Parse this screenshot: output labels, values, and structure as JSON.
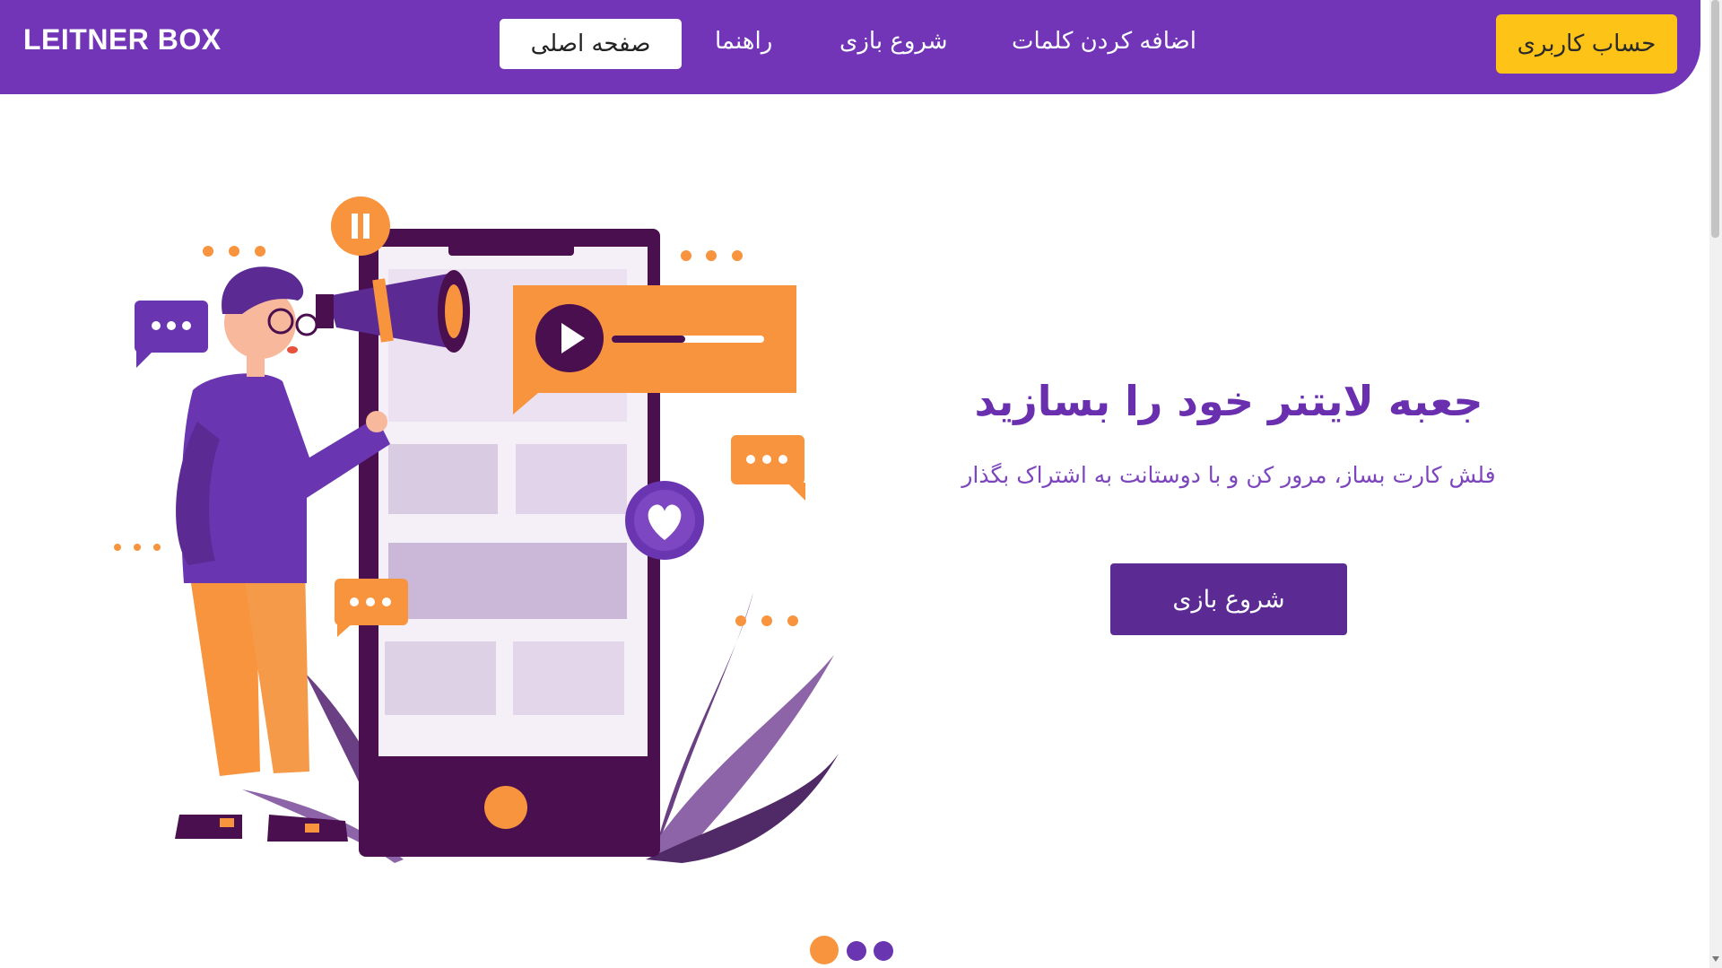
{
  "navbar": {
    "logo": "LEITNER BOX",
    "links": [
      {
        "label": "صفحه اصلی",
        "active": true
      },
      {
        "label": "راهنما"
      },
      {
        "label": "شروع بازی"
      },
      {
        "label": "اضافه کردن کلمات"
      }
    ],
    "account_button": "حساب کاربری"
  },
  "hero": {
    "title": "جعبه لایتنر خود را بسازید",
    "subtitle": "فلش کارت بساز، مرور کن و با دوستانت به اشتراک بگذار",
    "cta_button": "شروع بازی"
  },
  "carousel": {
    "slide_count": 3,
    "active_index": 0
  },
  "colors": {
    "primary": "#7235b7",
    "dark_purple": "#5b2a93",
    "accent_yellow": "#fdc316",
    "accent_orange": "#f7943d"
  },
  "illustration": {
    "icons": [
      "megaphone-icon",
      "play-icon",
      "pause-icon",
      "heart-icon",
      "chat-bubble-icon"
    ]
  }
}
